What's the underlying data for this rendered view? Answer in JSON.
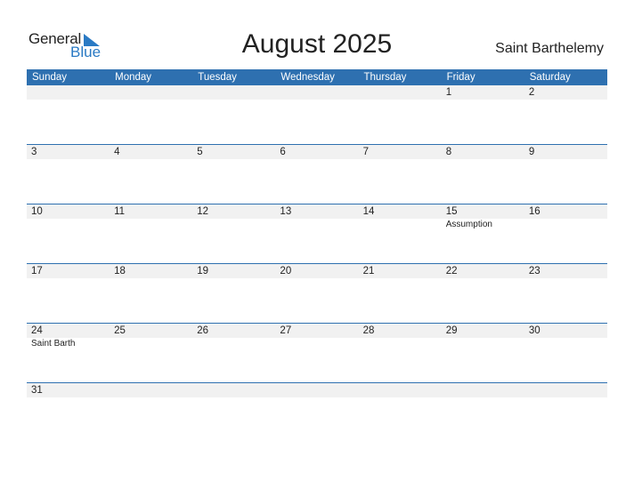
{
  "logo": {
    "text_general": "General",
    "text_blue": "Blue",
    "accent": "#2a7ac4"
  },
  "title": "August 2025",
  "country": "Saint Barthelemy",
  "colors": {
    "header_bg": "#2e70b0",
    "band_bg": "#f1f1f1"
  },
  "weekdays": [
    "Sunday",
    "Monday",
    "Tuesday",
    "Wednesday",
    "Thursday",
    "Friday",
    "Saturday"
  ],
  "weeks": [
    [
      {
        "day": ""
      },
      {
        "day": ""
      },
      {
        "day": ""
      },
      {
        "day": ""
      },
      {
        "day": ""
      },
      {
        "day": "1"
      },
      {
        "day": "2"
      }
    ],
    [
      {
        "day": "3"
      },
      {
        "day": "4"
      },
      {
        "day": "5"
      },
      {
        "day": "6"
      },
      {
        "day": "7"
      },
      {
        "day": "8"
      },
      {
        "day": "9"
      }
    ],
    [
      {
        "day": "10"
      },
      {
        "day": "11"
      },
      {
        "day": "12"
      },
      {
        "day": "13"
      },
      {
        "day": "14"
      },
      {
        "day": "15",
        "holiday": "Assumption"
      },
      {
        "day": "16"
      }
    ],
    [
      {
        "day": "17"
      },
      {
        "day": "18"
      },
      {
        "day": "19"
      },
      {
        "day": "20"
      },
      {
        "day": "21"
      },
      {
        "day": "22"
      },
      {
        "day": "23"
      }
    ],
    [
      {
        "day": "24",
        "holiday": "Saint Barth"
      },
      {
        "day": "25"
      },
      {
        "day": "26"
      },
      {
        "day": "27"
      },
      {
        "day": "28"
      },
      {
        "day": "29"
      },
      {
        "day": "30"
      }
    ],
    [
      {
        "day": "31"
      },
      {
        "day": ""
      },
      {
        "day": ""
      },
      {
        "day": ""
      },
      {
        "day": ""
      },
      {
        "day": ""
      },
      {
        "day": ""
      }
    ]
  ]
}
